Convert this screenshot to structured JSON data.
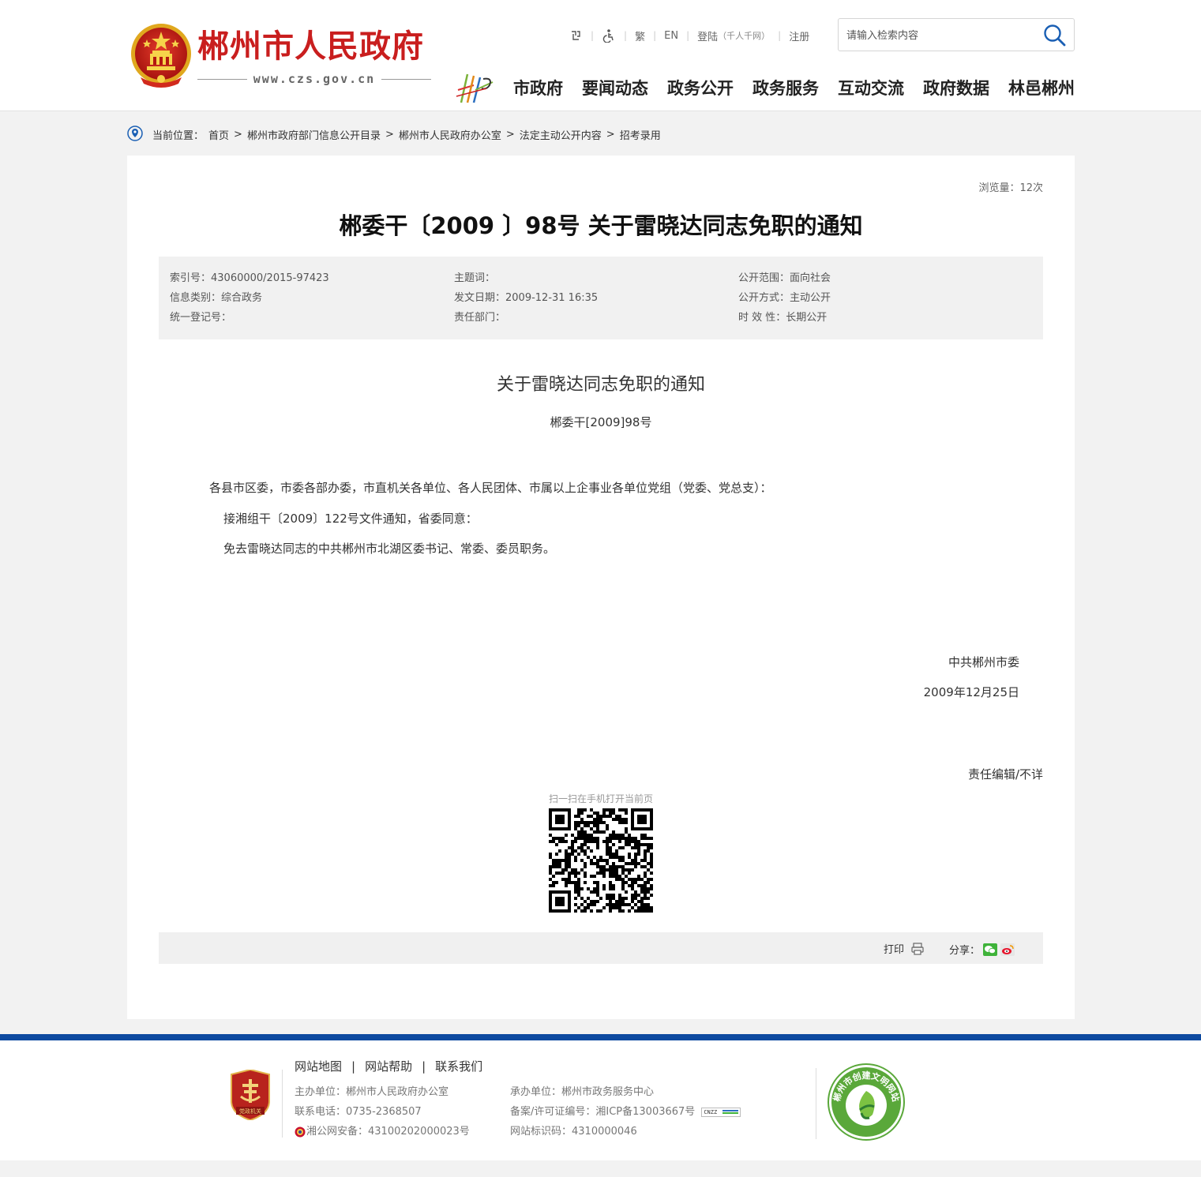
{
  "header": {
    "site_title": "郴州市人民政府",
    "site_url": "www.czs.gov.cn",
    "toplinks": {
      "trad": "繁",
      "en": "EN",
      "login": "登陆",
      "login_sub": "（千人千网）",
      "register": "注册"
    },
    "search_placeholder": "请输入检索内容",
    "nav": [
      "市政府",
      "要闻动态",
      "政务公开",
      "政务服务",
      "互动交流",
      "政府数据",
      "林邑郴州"
    ]
  },
  "breadcrumb": {
    "label": "当前位置：",
    "items": [
      "首页",
      "郴州市政府部门信息公开目录",
      "郴州市人民政府办公室",
      "法定主动公开内容",
      "招考录用"
    ],
    "separator": ">"
  },
  "article": {
    "views": "浏览量：12次",
    "title": "郴委干〔2009 〕98号 关于雷晓达同志免职的通知",
    "meta": [
      "索引号：43060000/2015-97423",
      "主题词：",
      "公开范围：面向社会",
      "信息类别：综合政务",
      "发文日期：2009-12-31 16:35",
      "公开方式：主动公开",
      "统一登记号：",
      "责任部门：",
      "时 效 性：长期公开"
    ],
    "heading": "关于雷晓达同志免职的通知",
    "doc_no": "郴委干[2009]98号",
    "paragraphs": [
      "各县市区委，市委各部办委，市直机关各单位、各人民团体、市属以上企事业各单位党组（党委、党总支）：",
      "接湘组干〔2009〕122号文件通知，省委同意：",
      "免去雷晓达同志的中共郴州市北湖区委书记、常委、委员职务。"
    ],
    "sign_org": "中共郴州市委",
    "sign_date": "2009年12月25日",
    "editor": "责任编辑/不详",
    "qr_caption": "扫一扫在手机打开当前页",
    "print_label": "打印",
    "share_label": "分享："
  },
  "footer": {
    "links": [
      "网站地图",
      "网站帮助",
      "联系我们"
    ],
    "col1": [
      "主办单位：郴州市人民政府办公室",
      "联系电话：0735-2368507",
      "湘公网安备：43100202000023号"
    ],
    "col2": [
      "承办单位：郴州市政务服务中心",
      "备案/许可证编号：湘ICP备13003667号",
      "网站标识码：4310000046"
    ],
    "cnzz": "CNZZ",
    "party_badge_text": "党政机关",
    "civil_badge_text": "郴州市创建文明网站"
  },
  "colors": {
    "brand_red": "#c91e1e",
    "footer_blue": "#0e4aa0",
    "search_blue": "#1a5fb4",
    "civil_green": "#5aa83a"
  }
}
